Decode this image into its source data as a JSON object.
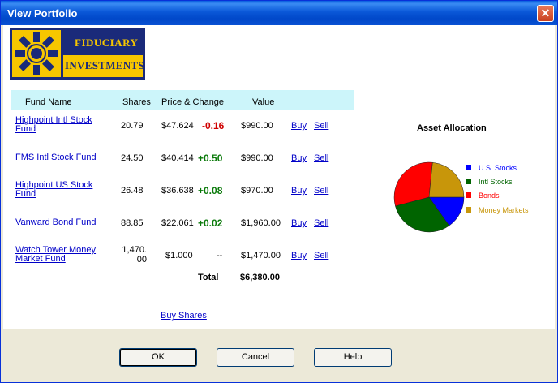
{
  "window": {
    "title": "View Portfolio",
    "close_glyph": "✕"
  },
  "logo": {
    "line1": "FIDUCIARY",
    "line2": "INVESTMENTS"
  },
  "table": {
    "headers": {
      "fund": "Fund Name",
      "shares": "Shares",
      "price": "Price & Change",
      "value": "Value"
    },
    "rows": [
      {
        "name_line1": "Highpoint Intl Stock",
        "name_line2": "Fund",
        "shares_line1": "20.79",
        "shares_line2": "",
        "price": "$47.624",
        "change": "-0.16",
        "change_dir": "neg",
        "value": "$990.00",
        "buy": "Buy",
        "sell": "Sell"
      },
      {
        "name_line1": "FMS Intl Stock Fund",
        "name_line2": "",
        "shares_line1": "24.50",
        "shares_line2": "",
        "price": "$40.414",
        "change": "+0.50",
        "change_dir": "pos",
        "value": "$990.00",
        "buy": "Buy",
        "sell": "Sell"
      },
      {
        "name_line1": "Highpoint US Stock",
        "name_line2": "Fund",
        "shares_line1": "26.48",
        "shares_line2": "",
        "price": "$36.638",
        "change": "+0.08",
        "change_dir": "pos",
        "value": "$970.00",
        "buy": "Buy",
        "sell": "Sell"
      },
      {
        "name_line1": "Vanward Bond Fund",
        "name_line2": "",
        "shares_line1": "88.85",
        "shares_line2": "",
        "price": "$22.061",
        "change": "+0.02",
        "change_dir": "pos",
        "value": "$1,960.00",
        "buy": "Buy",
        "sell": "Sell"
      },
      {
        "name_line1": "Watch Tower Money",
        "name_line2": "Market Fund",
        "shares_line1": "1,470.",
        "shares_line2": "00",
        "price": "$1.000",
        "change": "--",
        "change_dir": "none",
        "value": "$1,470.00",
        "buy": "Buy",
        "sell": "Sell"
      }
    ],
    "total_label": "Total",
    "total_value": "$6,380.00"
  },
  "buy_shares_link": "Buy Shares",
  "chart_data": {
    "type": "pie",
    "title": "Asset Allocation",
    "categories": [
      "U.S. Stocks",
      "Intl Stocks",
      "Bonds",
      "Money Markets"
    ],
    "values": [
      15.2,
      30.7,
      30.7,
      23.4
    ],
    "colors": [
      "#0000ff",
      "#006400",
      "#ff0000",
      "#c8960a"
    ]
  },
  "buttons": {
    "ok": "OK",
    "cancel": "Cancel",
    "help": "Help"
  }
}
